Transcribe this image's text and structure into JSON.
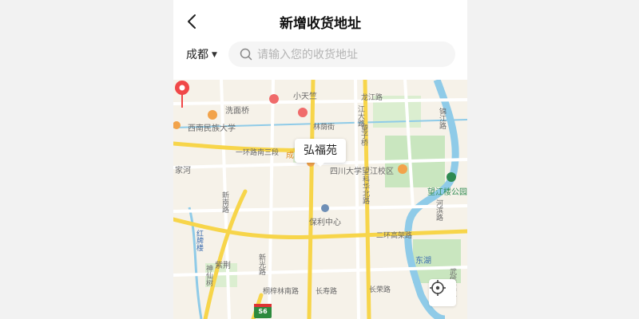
{
  "header": {
    "title": "新增收货地址",
    "back_icon": "chevron-left-icon"
  },
  "search": {
    "city": "成都",
    "placeholder": "请输入您的收货地址",
    "icon": "search-icon"
  },
  "map": {
    "selected_place": "弘福苑",
    "labels": {
      "xiaotianzhu": "小天竺",
      "ximianqiao": "洗面桥",
      "xinanminzu": "西南民族大学",
      "longjiang": "龙江路",
      "jiangjiang": "江大路",
      "jinjiang": "锦江路",
      "linyinjie": "林荫街",
      "ring1": "一环路南三段",
      "cheng": "成",
      "sichuan_uni": "四川大学望江校区",
      "wangjiang_park": "望江楼公园",
      "jiahe": "家河",
      "kehua": "科华北路",
      "wangzi": "望子桥",
      "baoli": "保利中心",
      "ring2": "二环高架路",
      "donghu": "东湖",
      "zijing": "紫荆",
      "xinnan": "新光路",
      "tongzi": "桐梓林南路",
      "changshou": "长寿路",
      "changrong": "长荣路",
      "jinxiu": "新南路",
      "jingjian": "新光路",
      "yongfeng": "锦江路",
      "shenxian": "神仙树",
      "hongpai": "红牌楼",
      "liangqiang": "河滨路",
      "zuo": "武侯大道"
    },
    "highway_shield": "S6",
    "locate_icon": "crosshair-icon",
    "pin_icon": "map-pin-icon"
  },
  "colors": {
    "map_bg": "#f6f2e9",
    "major_road": "#f7d54a",
    "minor_road": "#ffffff",
    "water": "#8fcbe8",
    "green": "#c9e6bf",
    "pin": "#f04848",
    "shield": "#2d8a3e"
  }
}
